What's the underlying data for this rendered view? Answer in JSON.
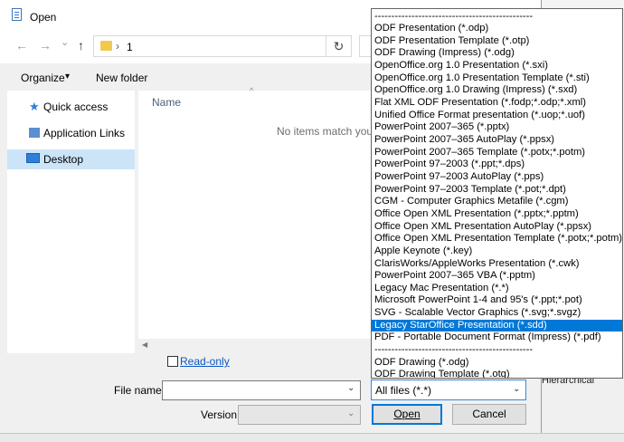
{
  "window": {
    "title": "Open"
  },
  "nav": {
    "back": "←",
    "forward": "→",
    "dropdown": "⌄",
    "up": "↑",
    "path_sep": "›",
    "path": "1",
    "refresh": "↻"
  },
  "toolbar": {
    "organize": "Organize",
    "organize_caret": "▾",
    "new_folder": "New folder"
  },
  "sidebar": {
    "items": [
      {
        "label": "Quick access",
        "icon": "star-icon"
      },
      {
        "label": "Application Links",
        "icon": "app-links-icon"
      },
      {
        "label": "Desktop",
        "icon": "desktop-icon",
        "selected": true
      }
    ]
  },
  "filelist": {
    "column_name": "Name",
    "sort_indicator": "^",
    "empty_message": "No items match your"
  },
  "form": {
    "readonly_label": "Read-only",
    "filename_label": "File name:",
    "filename_value": "",
    "version_label": "Version:",
    "version_value": "",
    "filter_value": "All files (*.*)",
    "open_label": "Open",
    "cancel_label": "Cancel"
  },
  "background": {
    "hierarchical_label": "Hierarchical"
  },
  "dropdown": {
    "selected_index": 25,
    "items": [
      "-----------------------------------------------",
      "ODF Presentation (*.odp)",
      "ODF Presentation Template (*.otp)",
      "ODF Drawing (Impress) (*.odg)",
      "OpenOffice.org 1.0 Presentation (*.sxi)",
      "OpenOffice.org 1.0 Presentation Template (*.sti)",
      "OpenOffice.org 1.0 Drawing (Impress) (*.sxd)",
      "Flat XML ODF Presentation (*.fodp;*.odp;*.xml)",
      "Unified Office Format presentation (*.uop;*.uof)",
      "PowerPoint 2007–365 (*.pptx)",
      "PowerPoint 2007–365 AutoPlay (*.ppsx)",
      "PowerPoint 2007–365 Template (*.potx;*.potm)",
      "PowerPoint 97–2003 (*.ppt;*.dps)",
      "PowerPoint 97–2003 AutoPlay (*.pps)",
      "PowerPoint 97–2003 Template (*.pot;*.dpt)",
      "CGM - Computer Graphics Metafile (*.cgm)",
      "Office Open XML Presentation (*.pptx;*.pptm)",
      "Office Open XML Presentation AutoPlay (*.ppsx)",
      "Office Open XML Presentation Template (*.potx;*.potm)",
      "Apple Keynote (*.key)",
      "ClarisWorks/AppleWorks Presentation (*.cwk)",
      "PowerPoint 2007–365 VBA (*.pptm)",
      "Legacy Mac Presentation (*.*)",
      "Microsoft PowerPoint 1-4 and 95's (*.ppt;*.pot)",
      "SVG - Scalable Vector Graphics (*.svg;*.svgz)",
      "Legacy StarOffice Presentation (*.sdd)",
      "PDF - Portable Document Format (Impress) (*.pdf)",
      "-----------------------------------------------",
      "ODF Drawing (*.odg)",
      "ODF Drawing Template (*.otg)"
    ]
  }
}
